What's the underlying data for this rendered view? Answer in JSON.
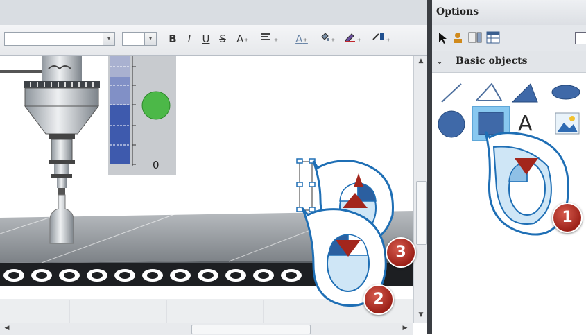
{
  "toolbar": {
    "bold_label": "B",
    "italic_label": "I",
    "underline_label": "U",
    "strike_label": "S",
    "fontsize_label": "A",
    "font_color_label": "A",
    "dropdown_glyph": "▾"
  },
  "canvas": {
    "bar_zero_label": "0",
    "indicator_color": "#4cb848"
  },
  "options_panel": {
    "title": "Options",
    "section_label": "Basic objects",
    "palette_items": [
      {
        "name": "line",
        "icon": "line-icon"
      },
      {
        "name": "polyline",
        "icon": "polyline-icon"
      },
      {
        "name": "polygon",
        "icon": "polygon-icon"
      },
      {
        "name": "ellipse",
        "icon": "ellipse-icon"
      },
      {
        "name": "circle",
        "icon": "circle-icon"
      },
      {
        "name": "rectangle",
        "icon": "rectangle-icon",
        "selected": true
      },
      {
        "name": "text-field",
        "icon": "text-icon",
        "text": "A"
      },
      {
        "name": "graphic-view",
        "icon": "image-icon"
      }
    ]
  },
  "callouts": [
    {
      "number": "1",
      "action": "click"
    },
    {
      "number": "2",
      "action": "click"
    },
    {
      "number": "3",
      "action": "drag"
    }
  ],
  "colors": {
    "accent_blue": "#1f6fb5",
    "callout_red": "#a3261c",
    "selection_blue": "#88c8f0"
  }
}
